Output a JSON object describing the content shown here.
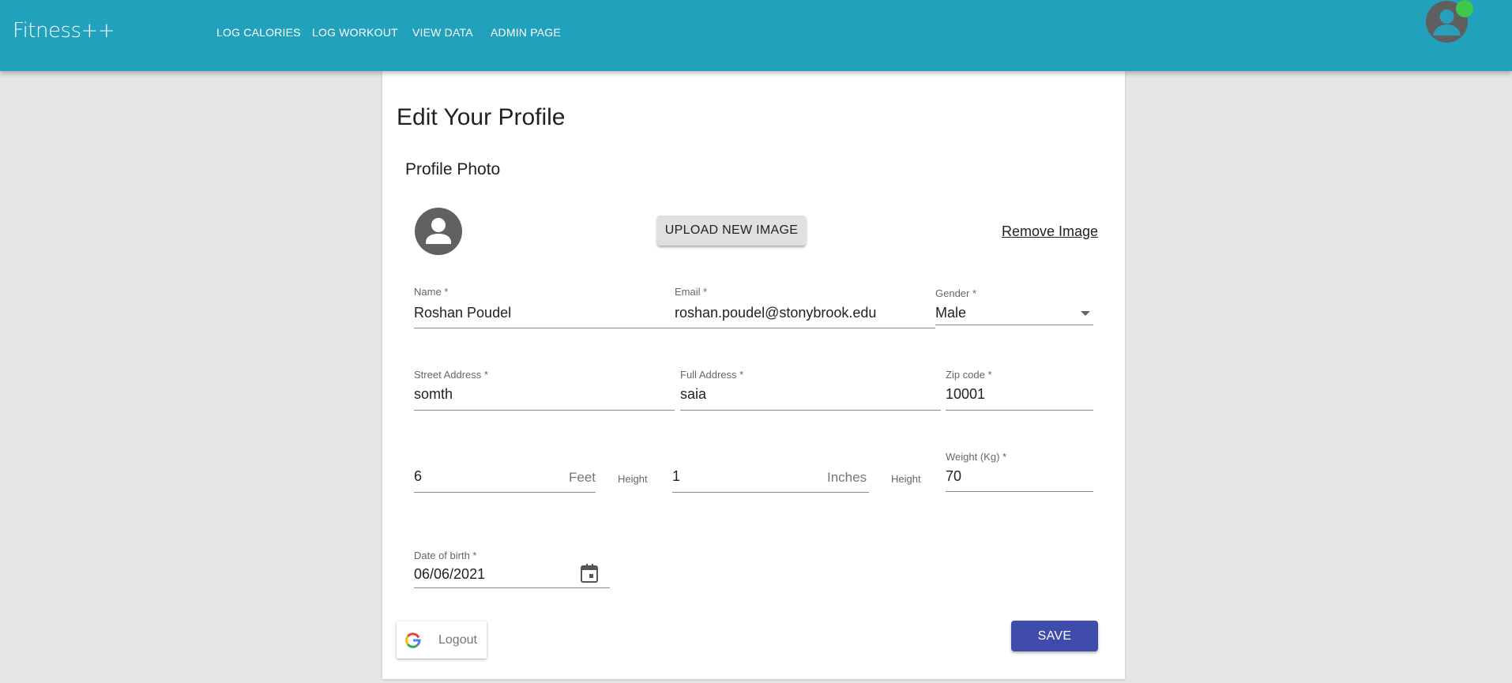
{
  "app": {
    "brand": "Fitness++",
    "nav": [
      "LOG CALORIES",
      "LOG WORKOUT",
      "VIEW DATA",
      "ADMIN PAGE"
    ],
    "avatar_icon": "account-circle-icon",
    "status_color": "#3ec74a",
    "appbar_color": "#21a1bc"
  },
  "profile": {
    "title": "Edit Your Profile",
    "photo_section_title": "Profile Photo",
    "upload_label": "UPLOAD NEW IMAGE",
    "remove_label": "Remove Image",
    "fields": {
      "name": {
        "label": "Name *",
        "value": "Roshan Poudel"
      },
      "email": {
        "label": "Email *",
        "value": "roshan.poudel@stonybrook.edu"
      },
      "gender": {
        "label": "Gender *",
        "value": "Male"
      },
      "street": {
        "label": "Street Address *",
        "value": "somth"
      },
      "full_address": {
        "label": "Full Address *",
        "value": "saia"
      },
      "zip": {
        "label": "Zip code *",
        "value": "10001"
      },
      "height_feet": {
        "value": "6",
        "unit": "Feet",
        "side_label": "Height"
      },
      "height_inches": {
        "value": "1",
        "unit": "Inches",
        "side_label": "Height"
      },
      "weight": {
        "label": "Weight (Kg) *",
        "value": "70"
      },
      "dob": {
        "label": "Date of birth *",
        "value": "06/06/2021"
      }
    },
    "logout_label": "Logout",
    "save_label": "SAVE",
    "save_color": "#3f4cac"
  }
}
